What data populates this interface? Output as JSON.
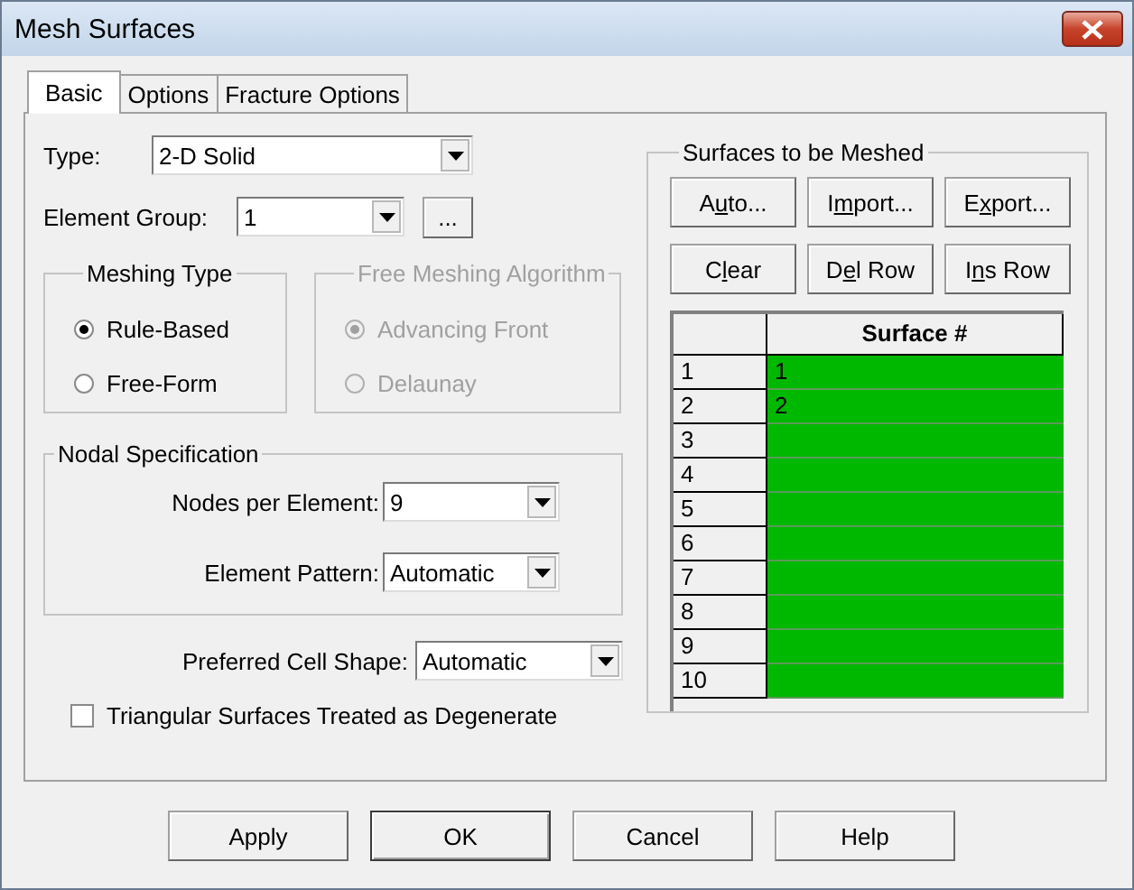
{
  "window": {
    "title": "Mesh Surfaces"
  },
  "tabs": [
    {
      "label": "Basic",
      "selected": true
    },
    {
      "label": "Options",
      "selected": false
    },
    {
      "label": "Fracture Options",
      "selected": false
    }
  ],
  "type": {
    "label": "Type:",
    "value": "2-D Solid"
  },
  "element_group": {
    "label": "Element Group:",
    "value": "1",
    "browse_button": "..."
  },
  "meshing_type": {
    "title": "Meshing Type",
    "disabled": false,
    "options": [
      {
        "label": "Rule-Based",
        "selected": true
      },
      {
        "label": "Free-Form",
        "selected": false
      }
    ]
  },
  "free_meshing_algorithm": {
    "title": "Free Meshing Algorithm",
    "disabled": true,
    "options": [
      {
        "label": "Advancing Front",
        "selected": true
      },
      {
        "label": "Delaunay",
        "selected": false
      }
    ]
  },
  "nodal_specification": {
    "title": "Nodal Specification",
    "fields": [
      {
        "label": "Nodes per Element:",
        "value": "9"
      },
      {
        "label": "Element Pattern:",
        "value": "Automatic"
      }
    ]
  },
  "preferred_cell_shape": {
    "label": "Preferred Cell Shape:",
    "value": "Automatic"
  },
  "triangular_degenerate": {
    "label": "Triangular Surfaces Treated as Degenerate",
    "checked": false
  },
  "surfaces": {
    "title": "Surfaces to be Meshed",
    "buttons": [
      {
        "label_start": "A",
        "mnemonic": "u",
        "label_end": "to..."
      },
      {
        "label_start": "I",
        "mnemonic": "m",
        "label_end": "port..."
      },
      {
        "label_start": "E",
        "mnemonic": "x",
        "label_end": "port..."
      },
      {
        "label_start": "C",
        "mnemonic": "l",
        "label_end": "ear"
      },
      {
        "label_start": "D",
        "mnemonic": "e",
        "label_end": "l Row"
      },
      {
        "label_start": "I",
        "mnemonic": "n",
        "label_end": "s Row"
      }
    ],
    "column": "Surface #",
    "rows": [
      {
        "index": "1",
        "value": "1"
      },
      {
        "index": "2",
        "value": "2"
      },
      {
        "index": "3"
      },
      {
        "index": "4"
      },
      {
        "index": "5"
      },
      {
        "index": "6"
      },
      {
        "index": "7"
      },
      {
        "index": "8"
      },
      {
        "index": "9"
      },
      {
        "index": "10"
      }
    ]
  },
  "footer_buttons": [
    {
      "label": "Apply",
      "default": false
    },
    {
      "label": "OK",
      "default": true
    },
    {
      "label": "Cancel",
      "default": false
    },
    {
      "label": "Help",
      "default": false
    }
  ]
}
